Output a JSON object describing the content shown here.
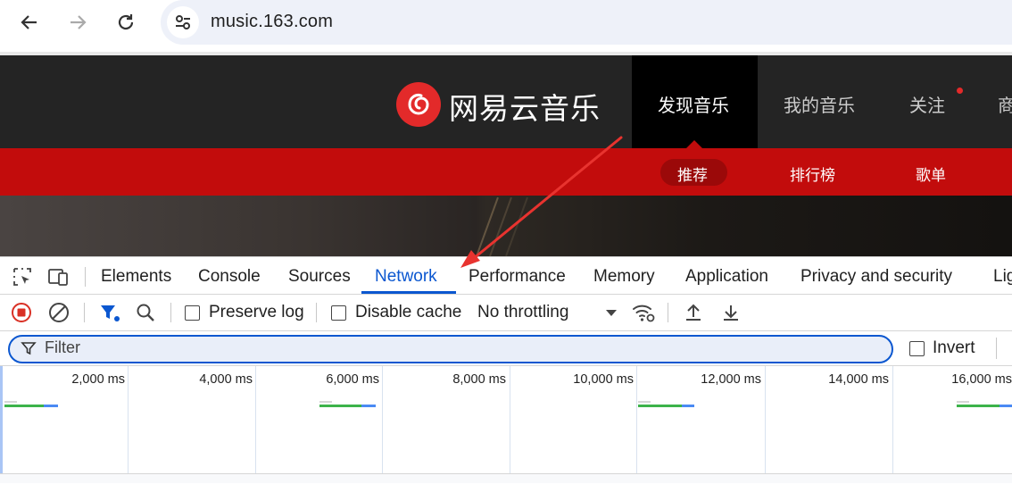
{
  "browser": {
    "url": "music.163.com",
    "icons": [
      "back-arrow-icon",
      "forward-arrow-icon",
      "reload-icon",
      "site-info-icon"
    ]
  },
  "site": {
    "logo_text": "网易云音乐",
    "nav": [
      "发现音乐",
      "我的音乐",
      "关注",
      "商"
    ],
    "active_nav": "发现音乐",
    "sub_nav": [
      "推荐",
      "排行榜",
      "歌单"
    ],
    "active_sub": "推荐",
    "brand_color": "#c20c0c"
  },
  "devtools": {
    "tabs": [
      "Elements",
      "Console",
      "Sources",
      "Network",
      "Performance",
      "Memory",
      "Application",
      "Privacy and security",
      "Lig"
    ],
    "active_tab": "Network",
    "toolbar": {
      "preserve_log": "Preserve log",
      "disable_cache": "Disable cache",
      "throttling": "No throttling"
    },
    "filter": {
      "placeholder": "Filter",
      "invert_label": "Invert"
    },
    "timeline_ticks": [
      "2,000 ms",
      "4,000 ms",
      "6,000 ms",
      "8,000 ms",
      "10,000 ms",
      "12,000 ms",
      "14,000 ms",
      "16,000 ms"
    ],
    "accent_color": "#0b57d0"
  }
}
